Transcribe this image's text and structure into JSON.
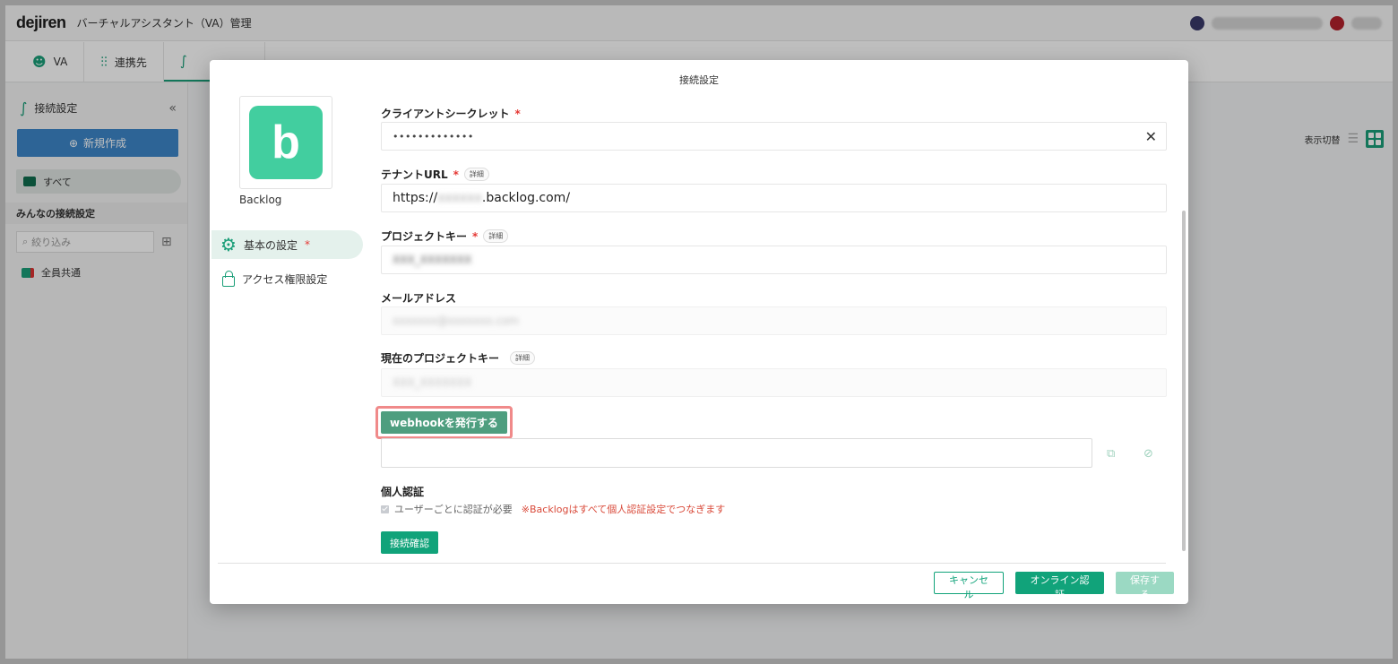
{
  "app": {
    "logo": "dejiren",
    "title": "バーチャルアシスタント（VA）管理"
  },
  "tabs": [
    {
      "label": "VA"
    },
    {
      "label": "連携先"
    }
  ],
  "sidebar": {
    "title": "接続設定",
    "new_button": "新規作成",
    "all_label": "すべて",
    "section_label": "みんなの接続設定",
    "filter_placeholder": "絞り込み",
    "member_item": "全員共通"
  },
  "main": {
    "view_toggle_label": "表示切替"
  },
  "modal": {
    "title": "接続設定",
    "service_name": "Backlog",
    "service_logo_letter": "b",
    "nav": {
      "basic": "基本の設定",
      "basic_required": "*",
      "access": "アクセス権限設定"
    },
    "fields": {
      "client_secret": {
        "label": "クライアントシークレット",
        "required": "*",
        "value": "•••••••••••••"
      },
      "tenant_url": {
        "label": "テナントURL",
        "required": "*",
        "detail": "詳細",
        "prefix": "https://",
        "masked": "xxxxxx",
        "suffix": ".backlog.com/"
      },
      "project_key": {
        "label": "プロジェクトキー",
        "required": "*",
        "detail": "詳細",
        "masked": "XXX_XXXXXXX"
      },
      "email": {
        "label": "メールアドレス",
        "masked": "xxxxxxx@xxxxxxx.com"
      },
      "current_project_key": {
        "label": "現在のプロジェクトキー",
        "detail": "詳細",
        "masked": "XXX_XXXXXXX"
      }
    },
    "webhook_button": "webhookを発行する",
    "personal_auth": {
      "label": "個人認証",
      "checkbox_label": "ユーザーごとに認証が必要",
      "warning": "※Backlogはすべて個人認証設定でつなぎます"
    },
    "verify_button": "接続確認",
    "footer": {
      "cancel": "キャンセル",
      "online_auth": "オンライン認証",
      "save": "保存する"
    }
  },
  "colors": {
    "accent": "#11a37a",
    "backlog_brand": "#42ce9f",
    "highlight": "#f08a8a",
    "required": "#e53935",
    "warning": "#d94a3a"
  }
}
